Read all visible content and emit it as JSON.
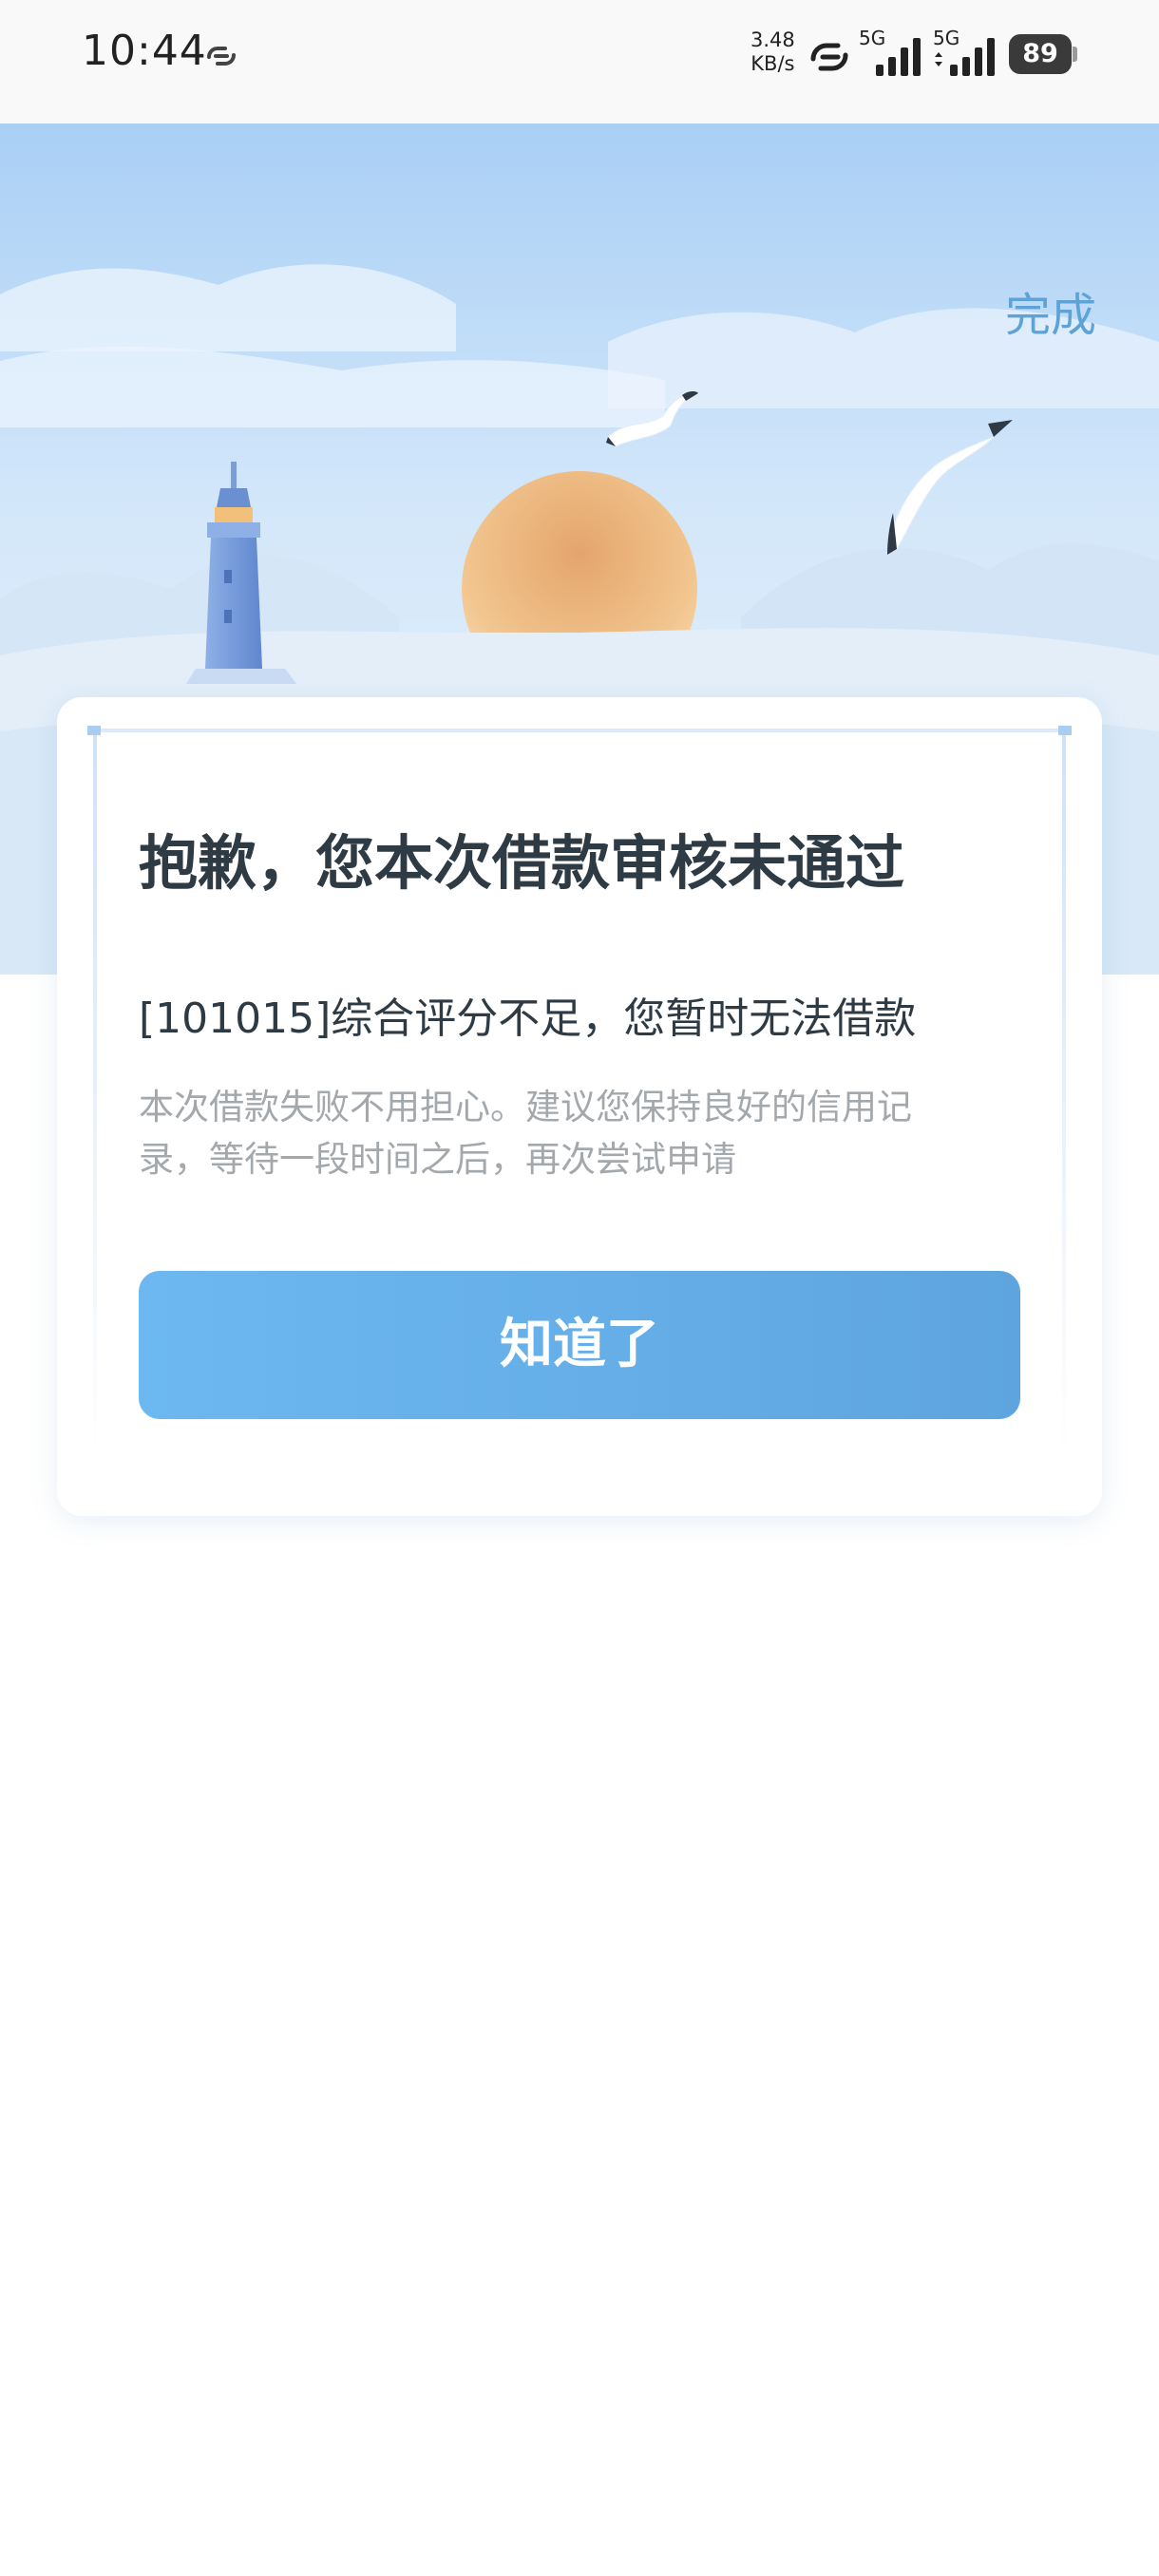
{
  "status_bar": {
    "time": "10:44",
    "net_speed_value": "3.48",
    "net_speed_unit": "KB/s",
    "signal_1_label": "5G",
    "signal_2_label": "5G",
    "battery": "89"
  },
  "header": {
    "done_label": "完成"
  },
  "result_card": {
    "title": "抱歉，您本次借款审核未通过",
    "reason": "[101015]综合评分不足，您暂时无法借款",
    "description_line1": "本次借款失败不用担心。建议您保持良好的信用记",
    "description_line2": "录，等待一段时间之后，再次尝试申请",
    "confirm_label": "知道了"
  },
  "colors": {
    "accent": "#5fa3d6",
    "button": "#6db8f1",
    "title_text": "#2e3a44",
    "muted_text": "#a3a8ad"
  }
}
